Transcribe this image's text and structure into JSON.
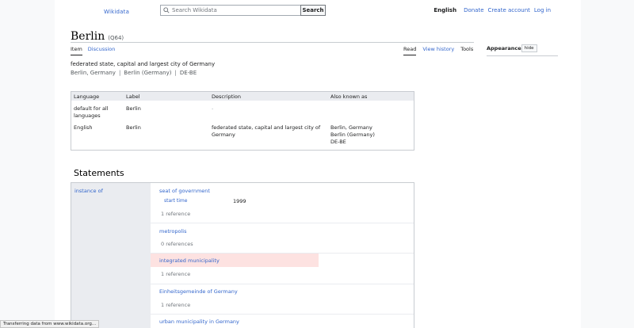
{
  "header": {
    "logo": "Wikidata",
    "search": {
      "placeholder": "Search Wikidata",
      "button": "Search"
    },
    "user_links": {
      "language": "English",
      "donate": "Donate",
      "create_account": "Create account",
      "log_in": "Log in"
    }
  },
  "item": {
    "label": "Berlin",
    "qid": "(Q64)",
    "description": "federated state, capital and largest city of Germany",
    "aliases": [
      "Berlin, Germany",
      "Berlin (Germany)",
      "DE-BE"
    ],
    "alias_separator": "|"
  },
  "tabs": {
    "left": [
      "Item",
      "Discussion"
    ],
    "right": [
      "Read",
      "View history",
      "Tools"
    ]
  },
  "appearance": {
    "title": "Appearance",
    "hide": "hide"
  },
  "terms_table": {
    "headers": [
      "Language",
      "Label",
      "Description",
      "Also known as"
    ],
    "rows": [
      {
        "language": "default for all languages",
        "label": "Berlin",
        "description": "-",
        "also_known_as": []
      },
      {
        "language": "English",
        "label": "Berlin",
        "description": "federated state, capital and largest city of Germany",
        "also_known_as": [
          "Berlin, Germany",
          "Berlin (Germany)",
          "DE-BE"
        ]
      }
    ]
  },
  "statements": {
    "heading": "Statements",
    "property": "instance of",
    "values": [
      {
        "label": "seat of government",
        "qualifier": {
          "name": "start time",
          "value": "1999"
        },
        "references": "1 reference",
        "highlighted": false
      },
      {
        "label": "metropolis",
        "references": "0 references",
        "highlighted": false
      },
      {
        "label": "integrated municipality",
        "references": "1 reference",
        "highlighted": true
      },
      {
        "label": "Einheitsgemeinde of Germany",
        "references": "1 reference",
        "highlighted": false
      },
      {
        "label": "urban municipality in Germany",
        "references": "",
        "highlighted": false
      }
    ]
  },
  "status_bar": "Transferring data from www.wikidata.org...",
  "colors": {
    "link": "#3366cc",
    "highlight": "#fde2e1",
    "panel": "#eaecf0"
  }
}
